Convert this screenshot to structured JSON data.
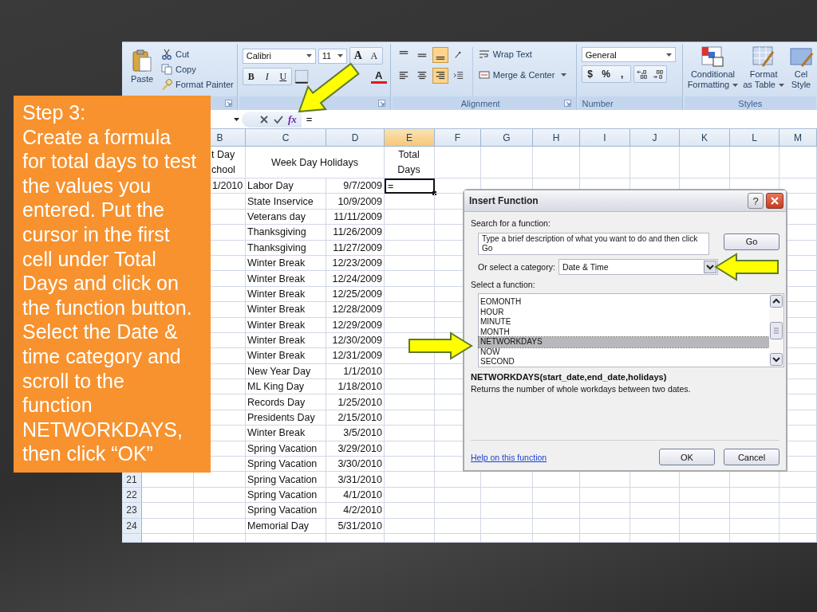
{
  "ribbon": {
    "clipboard": {
      "paste": "Paste",
      "cut": "Cut",
      "copy": "Copy",
      "format_painter": "Format Painter"
    },
    "font": {
      "name": "Calibri",
      "size": "11",
      "grow": "A",
      "shrink": "A",
      "bold": "B",
      "italic": "I",
      "underline": "U",
      "font_color": "A"
    },
    "alignment": {
      "vertical": [
        {
          "kind": "top",
          "selected": false
        },
        {
          "kind": "middle",
          "selected": false
        },
        {
          "kind": "bottom",
          "selected": true
        }
      ],
      "horizontal": [
        {
          "kind": "left",
          "selected": false
        },
        {
          "kind": "center",
          "selected": false
        },
        {
          "kind": "right",
          "selected": true
        }
      ],
      "wrap_text": "Wrap Text",
      "merge": "Merge & Center",
      "label": "Alignment"
    },
    "number": {
      "format": "General",
      "symbols": [
        "$",
        "%",
        ","
      ],
      "label": "Number"
    },
    "styles": {
      "items": [
        {
          "kind": "conditional",
          "lines": [
            "Conditional",
            "Formatting"
          ],
          "dropdown": true
        },
        {
          "kind": "table",
          "lines": [
            "Format",
            "as Table"
          ],
          "dropdown": true
        },
        {
          "kind": "cell",
          "lines": [
            "Cel",
            "Style"
          ],
          "dropdown": false
        }
      ],
      "label": "Styles"
    }
  },
  "formula_bar": {
    "function_button": "fx",
    "value": "="
  },
  "sheet": {
    "columns": [
      {
        "label": "B",
        "selected": false
      },
      {
        "label": "C",
        "selected": false
      },
      {
        "label": "D",
        "selected": false
      },
      {
        "label": "E",
        "selected": true
      },
      {
        "label": "F",
        "selected": false
      },
      {
        "label": "G",
        "selected": false
      },
      {
        "label": "H",
        "selected": false
      },
      {
        "label": "I",
        "selected": false
      },
      {
        "label": "J",
        "selected": false
      },
      {
        "label": "K",
        "selected": false
      },
      {
        "label": "L",
        "selected": false
      },
      {
        "label": "M",
        "selected": false
      }
    ],
    "header_row": {
      "b_lines": [
        "t Day",
        "chool"
      ],
      "c": "Week Day Holidays",
      "e_lines": [
        "Total",
        "Days"
      ]
    },
    "rows": [
      {
        "b": "1/2010",
        "c": "Labor Day",
        "d": "9/7/2009",
        "e": "=",
        "e_selected": true
      },
      {
        "c": "State Inservice",
        "d": "10/9/2009",
        "e_selected": false
      },
      {
        "c": "Veterans day",
        "d": "11/11/2009",
        "e_selected": false
      },
      {
        "c": "Thanksgiving",
        "d": "11/26/2009",
        "e_selected": false
      },
      {
        "c": "Thanksgiving",
        "d": "11/27/2009",
        "e_selected": false
      },
      {
        "c": "Winter Break",
        "d": "12/23/2009",
        "e_selected": false
      },
      {
        "c": "Winter Break",
        "d": "12/24/2009",
        "e_selected": false
      },
      {
        "c": "Winter Break",
        "d": "12/25/2009",
        "e_selected": false
      },
      {
        "c": "Winter Break",
        "d": "12/28/2009",
        "e_selected": false
      },
      {
        "c": "Winter Break",
        "d": "12/29/2009",
        "e_selected": false
      },
      {
        "c": "Winter Break",
        "d": "12/30/2009",
        "e_selected": false
      },
      {
        "c": "Winter Break",
        "d": "12/31/2009",
        "e_selected": false
      },
      {
        "c": "New Year Day",
        "d": "1/1/2010",
        "e_selected": false
      },
      {
        "c": "ML King Day",
        "d": "1/18/2010",
        "e_selected": false
      },
      {
        "c": "Records Day",
        "d": "1/25/2010",
        "e_selected": false
      },
      {
        "c": "Presidents Day",
        "d": "2/15/2010",
        "e_selected": false
      },
      {
        "c": "Winter Break",
        "d": "3/5/2010",
        "e_selected": false
      },
      {
        "c": "Spring Vacation",
        "d": "3/29/2010",
        "e_selected": false
      },
      {
        "c": "Spring Vacation",
        "d": "3/30/2010",
        "e_selected": false
      },
      {
        "number": "21",
        "c": "Spring Vacation",
        "d": "3/31/2010",
        "e_selected": false
      },
      {
        "number": "22",
        "c": "Spring Vacation",
        "d": "4/1/2010",
        "e_selected": false
      },
      {
        "number": "23",
        "c": "Spring Vacation",
        "d": "4/2/2010",
        "e_selected": false
      },
      {
        "number": "24",
        "c": "Memorial Day",
        "d": "5/31/2010",
        "e_selected": false
      }
    ]
  },
  "dialog": {
    "title": "Insert Function",
    "help": "?",
    "search_label": "Search for a function:",
    "search_value": "Type a brief description of what you want to do and then click Go",
    "go": "Go",
    "category_label": "Or select a category:",
    "category": "Date & Time",
    "function_label": "Select a function:",
    "functions": [
      {
        "name": "EOMONTH",
        "selected": false
      },
      {
        "name": "HOUR",
        "selected": false
      },
      {
        "name": "MINUTE",
        "selected": false
      },
      {
        "name": "MONTH",
        "selected": false
      },
      {
        "name": "NETWORKDAYS",
        "selected": true
      },
      {
        "name": "NOW",
        "selected": false
      },
      {
        "name": "SECOND",
        "selected": false
      }
    ],
    "signature": "NETWORKDAYS(start_date,end_date,holidays)",
    "description": "Returns the number of whole workdays between two dates.",
    "help_link": "Help on this function",
    "ok": "OK",
    "cancel": "Cancel"
  },
  "step": {
    "title": "Step 3:",
    "body": "Create a formula\nfor total days to test\nthe values you\nentered. Put the\ncursor in the first\ncell under Total\nDays and click on\nthe function button.\nSelect the Date &\ntime category and\nscroll to the\nfunction\nNETWORKDAYS,\nthen click “OK”"
  }
}
